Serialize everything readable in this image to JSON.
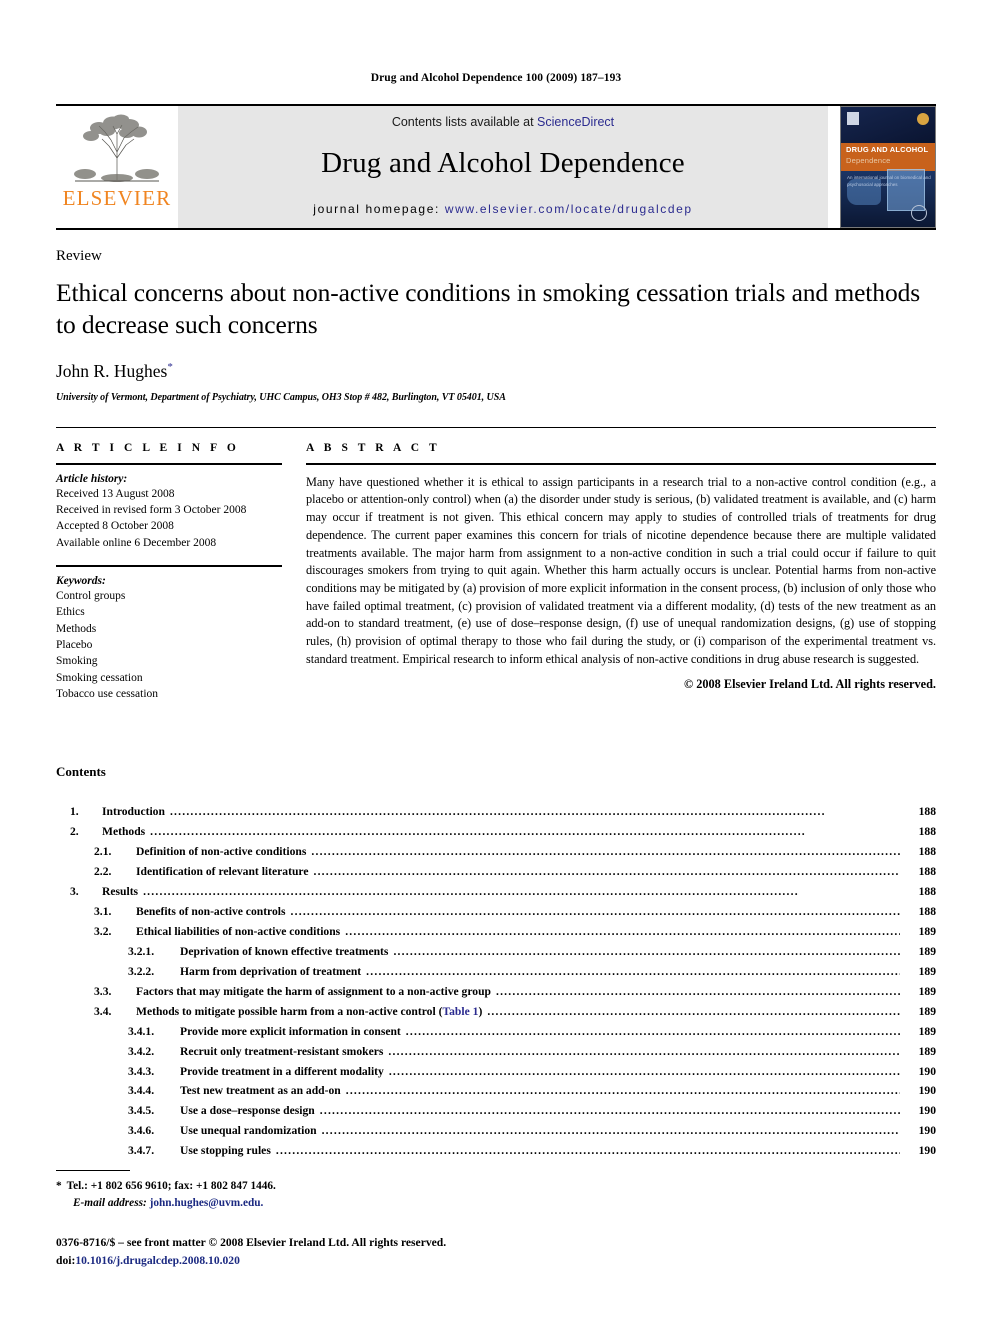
{
  "running_head": "Drug and Alcohol Dependence 100 (2009) 187–193",
  "masthead": {
    "publisher_wordmark": "ELSEVIER",
    "contents_prefix": "Contents lists available at ",
    "sciencedirect": "ScienceDirect",
    "journal_title": "Drug and Alcohol Dependence",
    "homepage_prefix": "journal homepage: ",
    "homepage_url": "www.elsevier.com/locate/drugalcdep",
    "cover": {
      "band_line1": "DRUG AND ALCOHOL",
      "band_line2": "Dependence",
      "small_text": "An international journal on biomedical\nand psychosocial approaches"
    },
    "link_color": "#2B2B8F",
    "brand_color": "#F08521",
    "band_color": "#C8621C"
  },
  "article": {
    "type": "Review",
    "title": "Ethical concerns about non-active conditions in smoking cessation trials and methods to decrease such concerns",
    "author": "John R. Hughes",
    "author_marker": "*",
    "affiliation": "University of Vermont, Department of Psychiatry, UHC Campus, OH3 Stop # 482, Burlington, VT 05401, USA"
  },
  "article_info": {
    "heading": "A R T I C L E   I N F O",
    "history_label": "Article history:",
    "history": [
      "Received 13 August 2008",
      "Received in revised form 3 October 2008",
      "Accepted 8 October 2008",
      "Available online 6 December 2008"
    ],
    "keywords_label": "Keywords:",
    "keywords": [
      "Control groups",
      "Ethics",
      "Methods",
      "Placebo",
      "Smoking",
      "Smoking cessation",
      "Tobacco use cessation"
    ]
  },
  "abstract": {
    "heading": "A B S T R A C T",
    "body": "Many have questioned whether it is ethical to assign participants in a research trial to a non-active control condition (e.g., a placebo or attention-only control) when (a) the disorder under study is serious, (b) validated treatment is available, and (c) harm may occur if treatment is not given. This ethical concern may apply to studies of controlled trials of treatments for drug dependence. The current paper examines this concern for trials of nicotine dependence because there are multiple validated treatments available. The major harm from assignment to a non-active condition in such a trial could occur if failure to quit discourages smokers from trying to quit again. Whether this harm actually occurs is unclear. Potential harms from non-active conditions may be mitigated by (a) provision of more explicit information in the consent process, (b) inclusion of only those who have failed optimal treatment, (c) provision of validated treatment via a different modality, (d) tests of the new treatment as an add-on to standard treatment, (e) use of dose–response design, (f) use of unequal randomization designs, (g) use of stopping rules, (h) provision of optimal therapy to those who fail during the study, or (i) comparison of the experimental treatment vs. standard treatment. Empirical research to inform ethical analysis of non-active conditions in drug abuse research is suggested.",
    "copyright": "© 2008 Elsevier Ireland Ltd. All rights reserved."
  },
  "contents": {
    "heading": "Contents",
    "entries": [
      {
        "level": 1,
        "num": "1.",
        "label": "Introduction",
        "page": "188"
      },
      {
        "level": 1,
        "num": "2.",
        "label": "Methods",
        "page": "188"
      },
      {
        "level": 2,
        "num": "2.1.",
        "label": "Definition of non-active conditions",
        "page": "188"
      },
      {
        "level": 2,
        "num": "2.2.",
        "label": "Identification of relevant literature",
        "page": "188"
      },
      {
        "level": 1,
        "num": "3.",
        "label": "Results",
        "page": "188"
      },
      {
        "level": 2,
        "num": "3.1.",
        "label": "Benefits of non-active controls",
        "page": "188"
      },
      {
        "level": 2,
        "num": "3.2.",
        "label": "Ethical liabilities of non-active conditions",
        "page": "189"
      },
      {
        "level": 3,
        "num": "3.2.1.",
        "label": "Deprivation of known effective treatments",
        "page": "189"
      },
      {
        "level": 3,
        "num": "3.2.2.",
        "label": "Harm from deprivation of treatment",
        "page": "189"
      },
      {
        "level": 2,
        "num": "3.3.",
        "label": "Factors that may mitigate the harm of assignment to a non-active group",
        "page": "189"
      },
      {
        "level": 2,
        "num": "3.4.",
        "label": "Methods to mitigate possible harm from a non-active control (",
        "link": "Table 1",
        "label_after": ")",
        "page": "189"
      },
      {
        "level": 3,
        "num": "3.4.1.",
        "label": "Provide more explicit information in consent",
        "page": "189"
      },
      {
        "level": 3,
        "num": "3.4.2.",
        "label": "Recruit only treatment-resistant smokers",
        "page": "189"
      },
      {
        "level": 3,
        "num": "3.4.3.",
        "label": "Provide treatment in a different modality",
        "page": "190"
      },
      {
        "level": 3,
        "num": "3.4.4.",
        "label": "Test new treatment as an add-on",
        "page": "190"
      },
      {
        "level": 3,
        "num": "3.4.5.",
        "label": "Use a dose–response design",
        "page": "190"
      },
      {
        "level": 3,
        "num": "3.4.6.",
        "label": "Use unequal randomization",
        "page": "190"
      },
      {
        "level": 3,
        "num": "3.4.7.",
        "label": "Use stopping rules",
        "page": "190"
      }
    ]
  },
  "footnotes": {
    "star": "*",
    "contact": "Tel.: +1 802 656 9610; fax: +1 802 847 1446.",
    "email_label": "E-mail address:",
    "email": "john.hughes@uvm.edu.",
    "issn_line": "0376-8716/$ – see front matter © 2008 Elsevier Ireland Ltd. All rights reserved.",
    "doi_label": "doi:",
    "doi": "10.1016/j.drugalcdep.2008.10.020"
  }
}
